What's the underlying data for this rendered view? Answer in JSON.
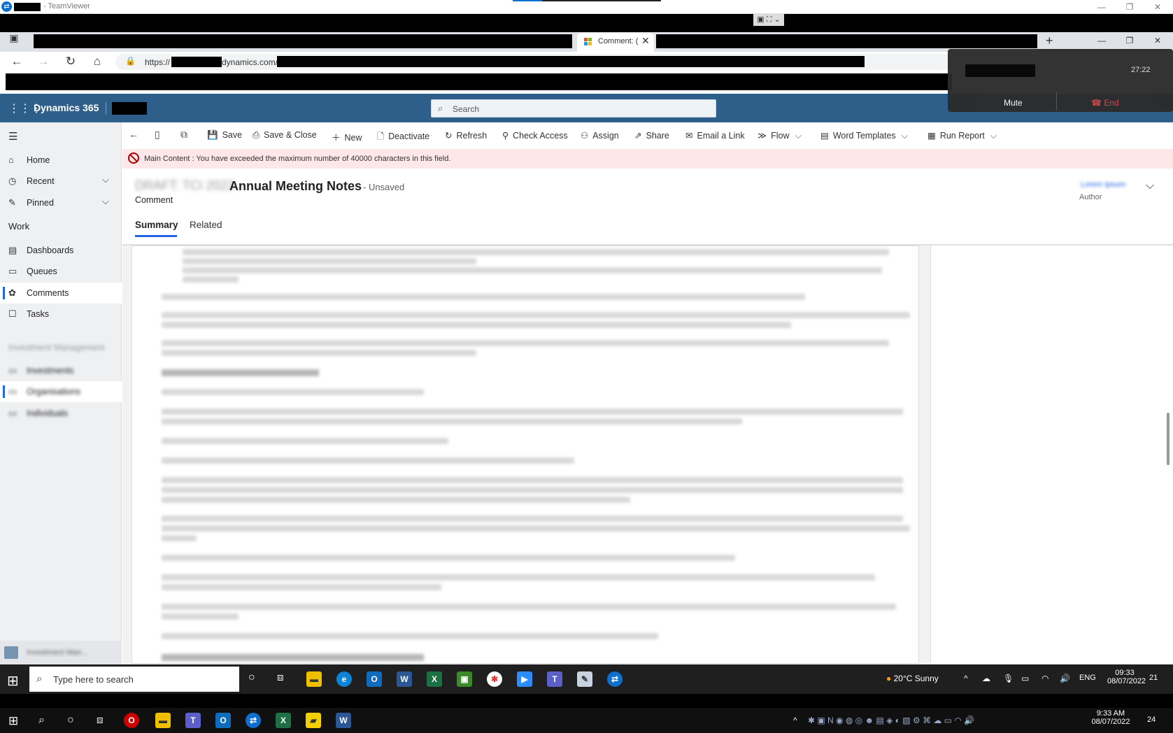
{
  "teamviewer": {
    "title": "- TeamViewer",
    "timer": "27:22",
    "mute_label": "Mute",
    "end_label": "End",
    "logo_icon": "teamviewer-icon",
    "controls_label": "▣ ⛶ ⌄"
  },
  "window_controls": {
    "minimize": "—",
    "restore": "❐",
    "close": "✕"
  },
  "browser": {
    "active_tab_label": "Comment: (",
    "tab_close": "✕",
    "new_tab": "+",
    "url_prefix": "https://",
    "url_domain": "dynamics.com/",
    "nav_icons": {
      "back": "←",
      "forward": "→",
      "reload": "↻",
      "home": "⌂",
      "lock": "🔒"
    }
  },
  "app": {
    "name": "Dynamics 365",
    "search_placeholder": "Search"
  },
  "sidebar": {
    "items": [
      {
        "label": "Home",
        "icon": "⌂"
      },
      {
        "label": "Recent",
        "icon": "◷",
        "chevron": "⌵"
      },
      {
        "label": "Pinned",
        "icon": "✎",
        "chevron": "⌵"
      }
    ],
    "work_header": "Work",
    "work_items": [
      {
        "label": "Dashboards",
        "icon": "▤"
      },
      {
        "label": "Queues",
        "icon": "▭"
      },
      {
        "label": "Comments",
        "icon": "✿"
      },
      {
        "label": "Tasks",
        "icon": "☐"
      }
    ],
    "area_header": "Investment Management",
    "area_items": [
      "Investments",
      "Organisations",
      "Individuals"
    ],
    "area_switcher": "Investment Man..."
  },
  "commands": {
    "save": "Save",
    "save_close": "Save & Close",
    "new": "New",
    "deactivate": "Deactivate",
    "refresh": "Refresh",
    "check_access": "Check Access",
    "assign": "Assign",
    "share": "Share",
    "email_link": "Email a Link",
    "flow": "Flow",
    "word_templates": "Word Templates",
    "run_report": "Run Report"
  },
  "error": {
    "message": "Main Content : You have exceeded the maximum number of 40000 characters in this field."
  },
  "record": {
    "title_prefix": "DRAFT: TCI 2022",
    "title": "Annual Meeting Notes",
    "status": "- Unsaved",
    "entity": "Comment",
    "owner_name": "Lorem Ipsum",
    "owner_label": "Author",
    "tabs": [
      "Summary",
      "Related"
    ]
  },
  "taskbar1": {
    "search_placeholder": "Type here to search",
    "weather": "20°C  Sunny",
    "language": "ENG",
    "time": "09:33",
    "date": "08/07/2022",
    "notifications": "21"
  },
  "taskbar2": {
    "time": "9:33 AM",
    "date": "08/07/2022",
    "notifications": "24"
  },
  "colors": {
    "header": "#2e5f8a",
    "accent": "#2266e3",
    "error_bg": "#fde7e9",
    "error": "#a80000"
  }
}
